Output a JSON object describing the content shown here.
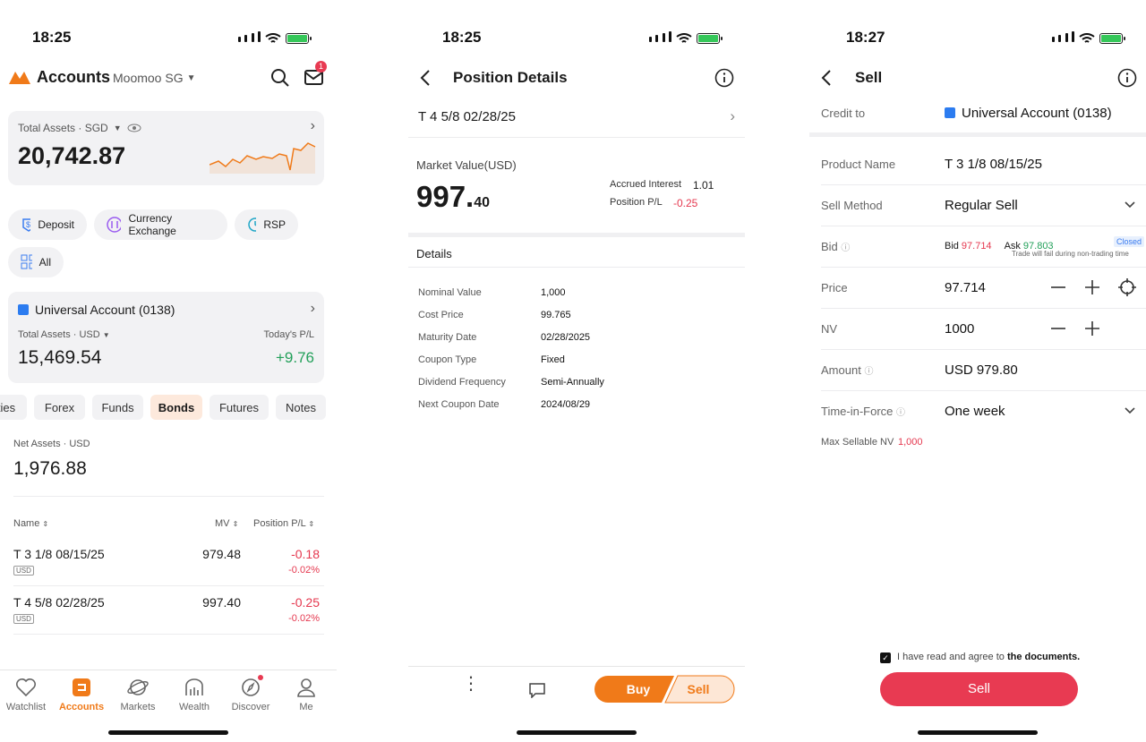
{
  "status": {
    "time1": "18:25",
    "time2": "18:25",
    "time3": "18:27"
  },
  "s1": {
    "title": "Accounts",
    "account_selector": "Moomoo SG",
    "notif_count": "1",
    "total_assets_label": "Total Assets · SGD",
    "total_assets_value": "20,742.87",
    "actions": [
      "Deposit",
      "Currency Exchange",
      "RSP",
      "All"
    ],
    "universal_account": "Universal Account (0138)",
    "ua_total_label": "Total Assets · USD",
    "ua_total_value": "15,469.54",
    "ua_pl_label": "Today's P/L",
    "ua_pl_value": "+9.76",
    "tabs": [
      "ties",
      "Forex",
      "Funds",
      "Bonds",
      "Futures",
      "Notes"
    ],
    "net_assets_label": "Net Assets · USD",
    "net_assets_value": "1,976.88",
    "col_name": "Name",
    "col_mv": "MV",
    "col_pl": "Position P/L",
    "rows": [
      {
        "name": "T 3 1/8 08/15/25",
        "ccy": "USD",
        "mv": "979.48",
        "pl": "-0.18",
        "pl_pct": "-0.02%"
      },
      {
        "name": "T 4 5/8 02/28/25",
        "ccy": "USD",
        "mv": "997.40",
        "pl": "-0.25",
        "pl_pct": "-0.02%"
      }
    ],
    "nav": [
      "Watchlist",
      "Accounts",
      "Markets",
      "Wealth",
      "Discover",
      "Me"
    ]
  },
  "s2": {
    "title": "Position Details",
    "product": "T 4 5/8 02/28/25",
    "mv_label": "Market Value(USD)",
    "mv_int": "997.",
    "mv_dec": "40",
    "accrued_label": "Accrued Interest",
    "accrued_value": "1.01",
    "ppl_label": "Position P/L",
    "ppl_value": "-0.25",
    "details_label": "Details",
    "details": [
      {
        "k": "Nominal Value",
        "v": "1,000"
      },
      {
        "k": "Cost Price",
        "v": "99.765"
      },
      {
        "k": "Maturity Date",
        "v": "02/28/2025"
      },
      {
        "k": "Coupon Type",
        "v": "Fixed"
      },
      {
        "k": "Dividend Frequency",
        "v": "Semi-Annually"
      },
      {
        "k": "Next Coupon Date",
        "v": "2024/08/29"
      }
    ],
    "buy": "Buy",
    "sell": "Sell"
  },
  "s3": {
    "title": "Sell",
    "credit_label": "Credit to",
    "credit_value": "Universal Account (0138)",
    "product_label": "Product Name",
    "product_value": "T 3 1/8 08/15/25",
    "method_label": "Sell Method",
    "method_value": "Regular Sell",
    "bid_label": "Bid",
    "bid_word": "Bid",
    "bid_value": "97.714",
    "ask_word": "Ask",
    "ask_value": "97.803",
    "closed": "Closed",
    "closed_note": "Trade will fail during non-trading time",
    "price_label": "Price",
    "price_value": "97.714",
    "nv_label": "NV",
    "nv_value": "1000",
    "amount_label": "Amount",
    "amount_value": "USD 979.80",
    "tif_label": "Time-in-Force",
    "tif_value": "One week",
    "max_label": "Max Sellable NV",
    "max_value": "1,000",
    "agree_text": "I have read and agree to",
    "agree_link": "the documents.",
    "sell_button": "Sell"
  },
  "colors": {
    "brand_orange": "#f07a19",
    "sell_red": "#e83a52",
    "up_green": "#23a05a"
  }
}
